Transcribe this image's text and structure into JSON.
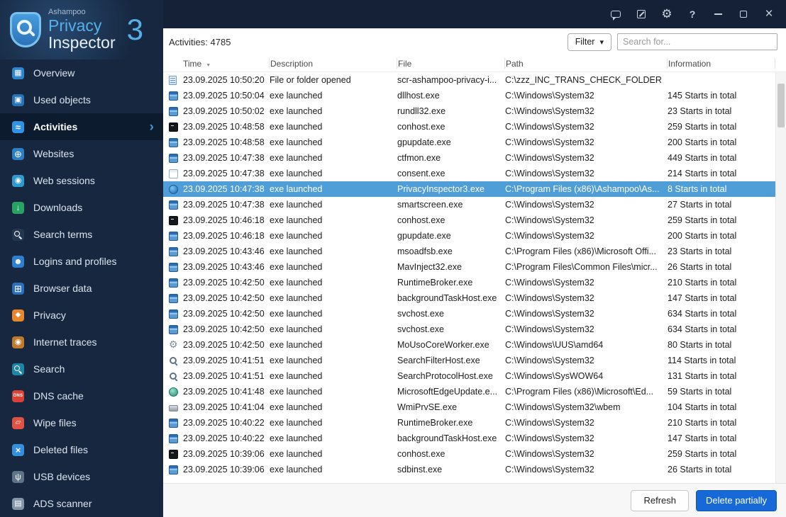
{
  "logo": {
    "brand": "Ashampoo",
    "product_line1": "Privacy",
    "product_line2": "Inspector",
    "version": "3"
  },
  "titlebar": {
    "icons": [
      {
        "id": "feedback",
        "name": "feedback-bubble-icon"
      },
      {
        "id": "notes",
        "name": "notes-icon"
      },
      {
        "id": "settings",
        "name": "settings-gear-icon"
      },
      {
        "id": "help",
        "name": "help-icon"
      },
      {
        "id": "minimize",
        "name": "minimize-icon"
      },
      {
        "id": "maximize",
        "name": "maximize-icon"
      },
      {
        "id": "close",
        "name": "close-icon"
      }
    ]
  },
  "sidebar": {
    "items": [
      {
        "id": "overview",
        "label": "Overview",
        "icon": "monitor-icon",
        "selected": false
      },
      {
        "id": "used-objects",
        "label": "Used objects",
        "icon": "box-icon",
        "selected": false
      },
      {
        "id": "activities",
        "label": "Activities",
        "icon": "activity-chart-icon",
        "selected": true
      },
      {
        "id": "websites",
        "label": "Websites",
        "icon": "globe-icon",
        "selected": false
      },
      {
        "id": "web-sessions",
        "label": "Web sessions",
        "icon": "session-icon",
        "selected": false
      },
      {
        "id": "downloads",
        "label": "Downloads",
        "icon": "download-icon",
        "selected": false
      },
      {
        "id": "search-terms",
        "label": "Search terms",
        "icon": "magnifier-icon",
        "selected": false
      },
      {
        "id": "logins-profiles",
        "label": "Logins and profiles",
        "icon": "user-icon",
        "selected": false
      },
      {
        "id": "browser-data",
        "label": "Browser data",
        "icon": "browser-window-icon",
        "selected": false
      },
      {
        "id": "privacy",
        "label": "Privacy",
        "icon": "shield-icon",
        "selected": false
      },
      {
        "id": "internet-traces",
        "label": "Internet traces",
        "icon": "cookie-icon",
        "selected": false
      },
      {
        "id": "search",
        "label": "Search",
        "icon": "globe-magnifier-icon",
        "selected": false
      },
      {
        "id": "dns-cache",
        "label": "DNS cache",
        "icon": "dns-badge-icon",
        "selected": false
      },
      {
        "id": "wipe-files",
        "label": "Wipe files",
        "icon": "eraser-icon",
        "selected": false
      },
      {
        "id": "deleted-files",
        "label": "Deleted files",
        "icon": "trash-icon",
        "selected": false
      },
      {
        "id": "usb-devices",
        "label": "USB devices",
        "icon": "usb-icon",
        "selected": false
      },
      {
        "id": "ads-scanner",
        "label": "ADS scanner",
        "icon": "document-scan-icon",
        "selected": false
      }
    ]
  },
  "toolbar": {
    "count_label": "Activities: 4785",
    "filter_label": "Filter",
    "search_placeholder": "Search for..."
  },
  "table": {
    "columns": [
      "Time",
      "Description",
      "File",
      "Path",
      "Information"
    ],
    "sorted_by": "Time",
    "sort_direction": "desc",
    "rows": [
      {
        "icon": "doc",
        "time": "23.09.2025 10:50:20",
        "description": "File or folder opened",
        "file": "scr-ashampoo-privacy-i...",
        "path": "C:\\zzz_INC_TRANS_CHECK_FOLDER",
        "information": "",
        "selected": false
      },
      {
        "icon": "window-blue",
        "time": "23.09.2025 10:50:04",
        "description": "exe launched",
        "file": "dllhost.exe",
        "path": "C:\\Windows\\System32",
        "information": "145 Starts in total",
        "selected": false
      },
      {
        "icon": "window-blue",
        "time": "23.09.2025 10:50:02",
        "description": "exe launched",
        "file": "rundll32.exe",
        "path": "C:\\Windows\\System32",
        "information": "23 Starts in total",
        "selected": false
      },
      {
        "icon": "terminal",
        "time": "23.09.2025 10:48:58",
        "description": "exe launched",
        "file": "conhost.exe",
        "path": "C:\\Windows\\System32",
        "information": "259 Starts in total",
        "selected": false
      },
      {
        "icon": "window-blue",
        "time": "23.09.2025 10:48:58",
        "description": "exe launched",
        "file": "gpupdate.exe",
        "path": "C:\\Windows\\System32",
        "information": "200 Starts in total",
        "selected": false
      },
      {
        "icon": "window-blue",
        "time": "23.09.2025 10:47:38",
        "description": "exe launched",
        "file": "ctfmon.exe",
        "path": "C:\\Windows\\System32",
        "information": "449 Starts in total",
        "selected": false
      },
      {
        "icon": "window-light",
        "time": "23.09.2025 10:47:38",
        "description": "exe launched",
        "file": "consent.exe",
        "path": "C:\\Windows\\System32",
        "information": "214 Starts in total",
        "selected": false
      },
      {
        "icon": "app-privacy",
        "time": "23.09.2025 10:47:38",
        "description": "exe launched",
        "file": "PrivacyInspector3.exe",
        "path": "C:\\Program Files (x86)\\Ashampoo\\As...",
        "information": "8 Starts in total",
        "selected": true
      },
      {
        "icon": "window-blue",
        "time": "23.09.2025 10:47:38",
        "description": "exe launched",
        "file": "smartscreen.exe",
        "path": "C:\\Windows\\System32",
        "information": "27 Starts in total",
        "selected": false
      },
      {
        "icon": "terminal",
        "time": "23.09.2025 10:46:18",
        "description": "exe launched",
        "file": "conhost.exe",
        "path": "C:\\Windows\\System32",
        "information": "259 Starts in total",
        "selected": false
      },
      {
        "icon": "window-blue",
        "time": "23.09.2025 10:46:18",
        "description": "exe launched",
        "file": "gpupdate.exe",
        "path": "C:\\Windows\\System32",
        "information": "200 Starts in total",
        "selected": false
      },
      {
        "icon": "window-blue",
        "time": "23.09.2025 10:43:46",
        "description": "exe launched",
        "file": "msoadfsb.exe",
        "path": "C:\\Program Files (x86)\\Microsoft Offi...",
        "information": "23 Starts in total",
        "selected": false
      },
      {
        "icon": "window-blue",
        "time": "23.09.2025 10:43:46",
        "description": "exe launched",
        "file": "MavInject32.exe",
        "path": "C:\\Program Files\\Common Files\\micr...",
        "information": "26 Starts in total",
        "selected": false
      },
      {
        "icon": "window-blue",
        "time": "23.09.2025 10:42:50",
        "description": "exe launched",
        "file": "RuntimeBroker.exe",
        "path": "C:\\Windows\\System32",
        "information": "210 Starts in total",
        "selected": false
      },
      {
        "icon": "window-blue",
        "time": "23.09.2025 10:42:50",
        "description": "exe launched",
        "file": "backgroundTaskHost.exe",
        "path": "C:\\Windows\\System32",
        "information": "147 Starts in total",
        "selected": false
      },
      {
        "icon": "window-blue",
        "time": "23.09.2025 10:42:50",
        "description": "exe launched",
        "file": "svchost.exe",
        "path": "C:\\Windows\\System32",
        "information": "634 Starts in total",
        "selected": false
      },
      {
        "icon": "window-blue",
        "time": "23.09.2025 10:42:50",
        "description": "exe launched",
        "file": "svchost.exe",
        "path": "C:\\Windows\\System32",
        "information": "634 Starts in total",
        "selected": false
      },
      {
        "icon": "gear",
        "time": "23.09.2025 10:42:50",
        "description": "exe launched",
        "file": "MoUsoCoreWorker.exe",
        "path": "C:\\Windows\\UUS\\amd64",
        "information": "80 Starts in total",
        "selected": false
      },
      {
        "icon": "magnifier",
        "time": "23.09.2025 10:41:51",
        "description": "exe launched",
        "file": "SearchFilterHost.exe",
        "path": "C:\\Windows\\System32",
        "information": "114 Starts in total",
        "selected": false
      },
      {
        "icon": "magnifier",
        "time": "23.09.2025 10:41:51",
        "description": "exe launched",
        "file": "SearchProtocolHost.exe",
        "path": "C:\\Windows\\SysWOW64",
        "information": "131 Starts in total",
        "selected": false
      },
      {
        "icon": "globe",
        "time": "23.09.2025 10:41:48",
        "description": "exe launched",
        "file": "MicrosoftEdgeUpdate.e...",
        "path": "C:\\Program Files (x86)\\Microsoft\\Ed...",
        "information": "59 Starts in total",
        "selected": false
      },
      {
        "icon": "disk",
        "time": "23.09.2025 10:41:04",
        "description": "exe launched",
        "file": "WmiPrvSE.exe",
        "path": "C:\\Windows\\System32\\wbem",
        "information": "104 Starts in total",
        "selected": false
      },
      {
        "icon": "window-blue",
        "time": "23.09.2025 10:40:22",
        "description": "exe launched",
        "file": "RuntimeBroker.exe",
        "path": "C:\\Windows\\System32",
        "information": "210 Starts in total",
        "selected": false
      },
      {
        "icon": "window-blue",
        "time": "23.09.2025 10:40:22",
        "description": "exe launched",
        "file": "backgroundTaskHost.exe",
        "path": "C:\\Windows\\System32",
        "information": "147 Starts in total",
        "selected": false
      },
      {
        "icon": "terminal",
        "time": "23.09.2025 10:39:06",
        "description": "exe launched",
        "file": "conhost.exe",
        "path": "C:\\Windows\\System32",
        "information": "259 Starts in total",
        "selected": false
      },
      {
        "icon": "window-blue",
        "time": "23.09.2025 10:39:06",
        "description": "exe launched",
        "file": "sdbinst.exe",
        "path": "C:\\Windows\\System32",
        "information": "26 Starts in total",
        "selected": false
      }
    ]
  },
  "footer": {
    "refresh_label": "Refresh",
    "delete_label": "Delete partially"
  },
  "colors": {
    "accent_blue": "#58aee8",
    "selected_row": "#4f9ed7",
    "primary_button": "#1669d6",
    "sidebar_bg": "#16273f",
    "titlebar_bg": "#142136"
  }
}
